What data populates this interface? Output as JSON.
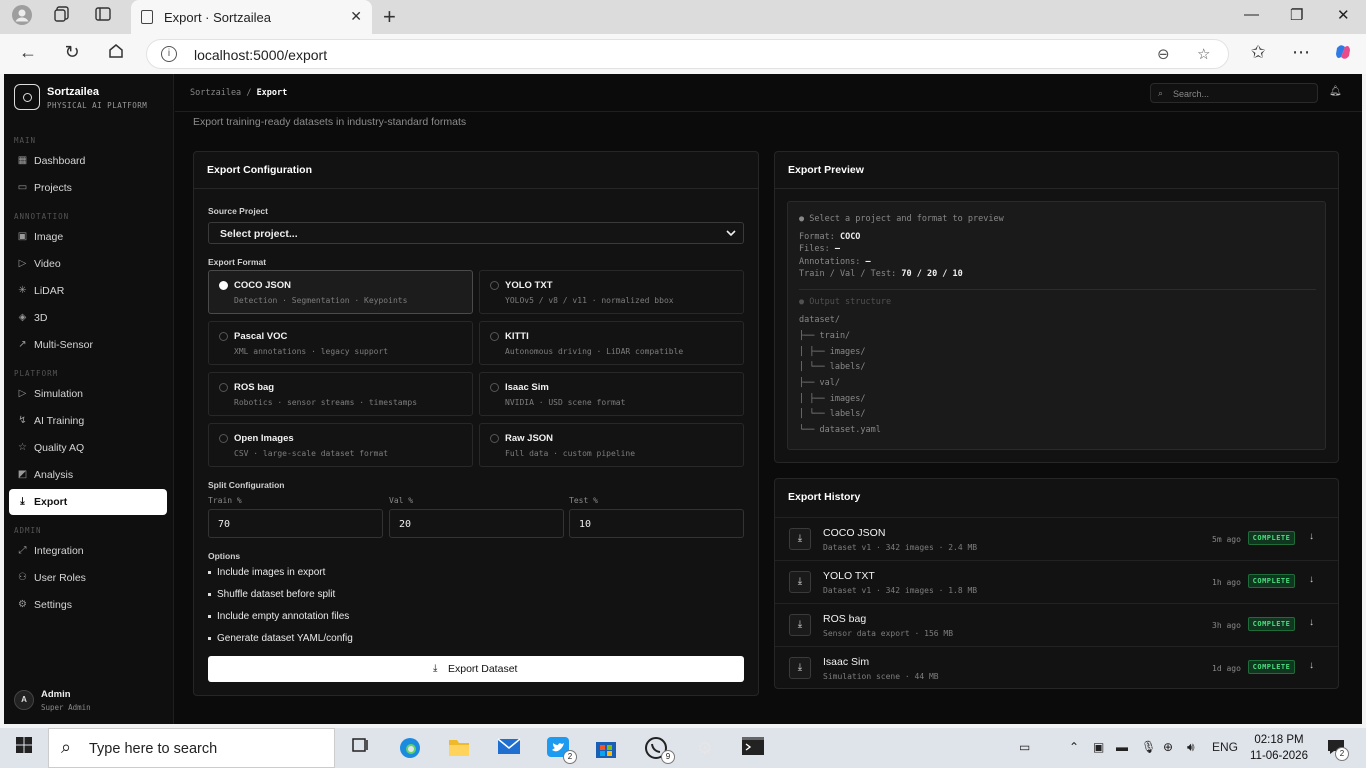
{
  "browser": {
    "tab_title": "Export · Sortzailea",
    "url": "localhost:5000/export"
  },
  "app": {
    "brand_name": "Sortzailea",
    "brand_tag": "PHYSICAL AI PLATFORM",
    "sections": {
      "main": "MAIN",
      "annotation": "ANNOTATION",
      "platform": "PLATFORM",
      "admin": "ADMIN"
    },
    "nav": {
      "dashboard": "Dashboard",
      "projects": "Projects",
      "image": "Image",
      "video": "Video",
      "lidar": "LiDAR",
      "3d": "3D",
      "multisensor": "Multi-Sensor",
      "simulation": "Simulation",
      "ai_training": "AI Training",
      "quality": "Quality AQ",
      "analysis": "Analysis",
      "export": "Export",
      "integration": "Integration",
      "user_roles": "User Roles",
      "settings": "Settings"
    },
    "user": {
      "initial": "A",
      "name": "Admin",
      "role": "Super Admin"
    }
  },
  "topbar": {
    "crumb_root": "Sortzailea",
    "crumb_sep": "/",
    "crumb_current": "Export",
    "search_placeholder": "Search..."
  },
  "page": {
    "subtitle": "Export training-ready datasets in industry-standard formats"
  },
  "config": {
    "title": "Export Configuration",
    "source_label": "Source Project",
    "source_value": "Select project...",
    "format_label": "Export Format",
    "formats": [
      {
        "name": "COCO JSON",
        "desc": "Detection · Segmentation · Keypoints"
      },
      {
        "name": "YOLO TXT",
        "desc": "YOLOv5 / v8 / v11 · normalized bbox"
      },
      {
        "name": "Pascal VOC",
        "desc": "XML annotations · legacy support"
      },
      {
        "name": "KITTI",
        "desc": "Autonomous driving · LiDAR compatible"
      },
      {
        "name": "ROS bag",
        "desc": "Robotics · sensor streams · timestamps"
      },
      {
        "name": "Isaac Sim",
        "desc": "NVIDIA · USD scene format"
      },
      {
        "name": "Open Images",
        "desc": "CSV · large-scale dataset format"
      },
      {
        "name": "Raw JSON",
        "desc": "Full data · custom pipeline"
      }
    ],
    "selected_format": "COCO JSON",
    "split_label": "Split Configuration",
    "train_label": "Train %",
    "val_label": "Val %",
    "test_label": "Test %",
    "train_value": "70",
    "val_value": "20",
    "test_value": "10",
    "options_label": "Options",
    "options": [
      "Include images in export",
      "Shuffle dataset before split",
      "Include empty annotation files",
      "Generate dataset YAML/config"
    ],
    "export_button": "Export Dataset"
  },
  "preview": {
    "title": "Export Preview",
    "hint": "● Select a project and format to preview",
    "format_k": "Format: ",
    "format_v": "COCO",
    "files_k": "Files: ",
    "files_v": "—",
    "ann_k": "Annotations: ",
    "ann_v": "—",
    "split_k": "Train / Val / Test: ",
    "split_v": "70 / 20 / 10",
    "structure_title": "● Output structure",
    "tree": [
      "dataset/",
      "├── train/",
      "│ ├── images/",
      "│ └── labels/",
      "├── val/",
      "│ ├── images/",
      "│ └── labels/",
      "└── dataset.yaml"
    ]
  },
  "history": {
    "title": "Export History",
    "items": [
      {
        "name": "COCO JSON",
        "meta": "Dataset v1 · 342 images · 2.4 MB",
        "time": "5m ago",
        "status": "COMPLETE"
      },
      {
        "name": "YOLO TXT",
        "meta": "Dataset v1 · 342 images · 1.8 MB",
        "time": "1h ago",
        "status": "COMPLETE"
      },
      {
        "name": "ROS bag",
        "meta": "Sensor data export · 156 MB",
        "time": "3h ago",
        "status": "COMPLETE"
      },
      {
        "name": "Isaac Sim",
        "meta": "Simulation scene · 44 MB",
        "time": "1d ago",
        "status": "COMPLETE"
      }
    ]
  },
  "taskbar": {
    "search_placeholder": "Type here to search",
    "twitter_badge": "2",
    "whatsapp_badge": "9",
    "lang": "ENG",
    "time": "02:18 PM",
    "date": "11-06-2026",
    "notif_badge": "2"
  },
  "colors": {
    "accent": "#ffffff",
    "success": "#4ade80",
    "background": "#0b0b0b"
  }
}
